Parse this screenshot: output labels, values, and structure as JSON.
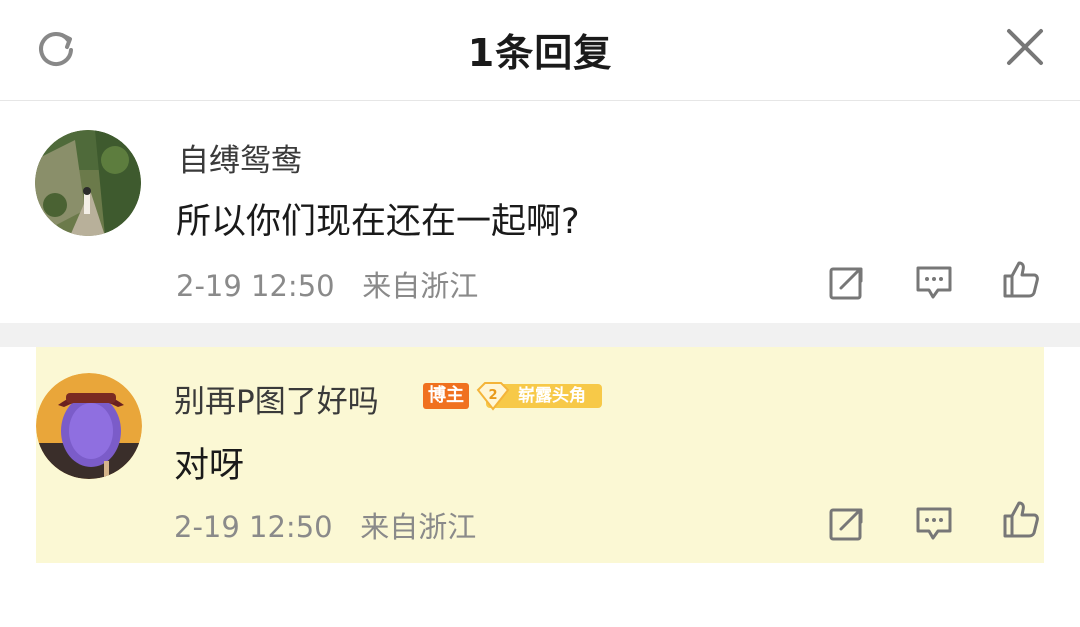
{
  "header": {
    "title": "1条回复",
    "refresh_icon": "refresh-icon",
    "close_icon": "close-icon"
  },
  "comments": [
    {
      "username": "自缚鸳鸯",
      "text": "所以你们现在还在一起啊?",
      "time": "2-19 12:50",
      "location": "来自浙江",
      "avatar": "garden-photo-avatar",
      "actions": [
        "share-icon",
        "comment-icon",
        "like-icon"
      ]
    },
    {
      "username": "别再P图了好吗",
      "badge_host": "博主",
      "badge_level_num": "2",
      "badge_level_text": "崭露头角",
      "text": "对呀",
      "time": "2-19 12:50",
      "location": "来自浙江",
      "avatar": "purple-face-avatar",
      "actions": [
        "share-icon",
        "comment-icon",
        "like-icon"
      ],
      "highlight_color": "#fbf8d4"
    }
  ],
  "colors": {
    "host_badge": "#f0711f",
    "level_badge": "#f7c948",
    "meta_text": "#8a8a8a"
  }
}
